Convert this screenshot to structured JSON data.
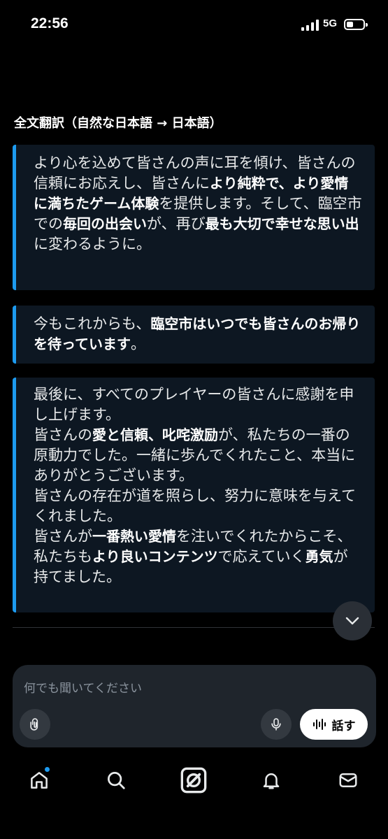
{
  "status_bar": {
    "time": "22:56",
    "network": "5G"
  },
  "heading": "全文翻訳（自然な日本語 → 日本語）",
  "blocks": [
    {
      "segments": [
        {
          "t": "より心を込めて皆さんの声に耳を傾け、皆さんの信頼にお応えし、皆さんに",
          "b": false
        },
        {
          "t": "より純粋で、より愛情に満ちたゲーム体験",
          "b": true
        },
        {
          "t": "を提供します。そして、臨空市での",
          "b": false
        },
        {
          "t": "毎回の出会い",
          "b": true
        },
        {
          "t": "が、再び",
          "b": false
        },
        {
          "t": "最も大切で幸せな思い出",
          "b": true
        },
        {
          "t": "に変わるように。",
          "b": false
        }
      ]
    },
    {
      "segments": [
        {
          "t": "今もこれからも、",
          "b": false
        },
        {
          "t": "臨空市はいつでも皆さんのお帰りを待っています",
          "b": true
        },
        {
          "t": "。",
          "b": false
        }
      ]
    },
    {
      "segments": [
        {
          "t": "最後に、すべてのプレイヤーの皆さんに感謝を申し上げます。\n皆さんの",
          "b": false
        },
        {
          "t": "愛と信頼、叱咤激励",
          "b": true
        },
        {
          "t": "が、私たちの一番の原動力でした。一緒に歩んでくれたこと、本当にありがとうございます。\n皆さんの存在が道を照らし、努力に意味を与えてくれました。\n皆さんが",
          "b": false
        },
        {
          "t": "一番熱い愛情",
          "b": true
        },
        {
          "t": "を注いでくれたからこそ、私たちも",
          "b": false
        },
        {
          "t": "より良いコンテンツ",
          "b": true
        },
        {
          "t": "で応えていく",
          "b": false
        },
        {
          "t": "勇気",
          "b": true
        },
        {
          "t": "が持てました。",
          "b": false
        }
      ]
    }
  ],
  "composer": {
    "placeholder": "何でも聞いてください",
    "talk_label": "話す"
  },
  "nav": [
    "home-icon",
    "search-icon",
    "grok-icon",
    "notifications-icon",
    "messages-icon"
  ],
  "colors": {
    "accent": "#1d9bf0",
    "block_bg": "#0d1722",
    "composer_bg": "#1f252c"
  }
}
